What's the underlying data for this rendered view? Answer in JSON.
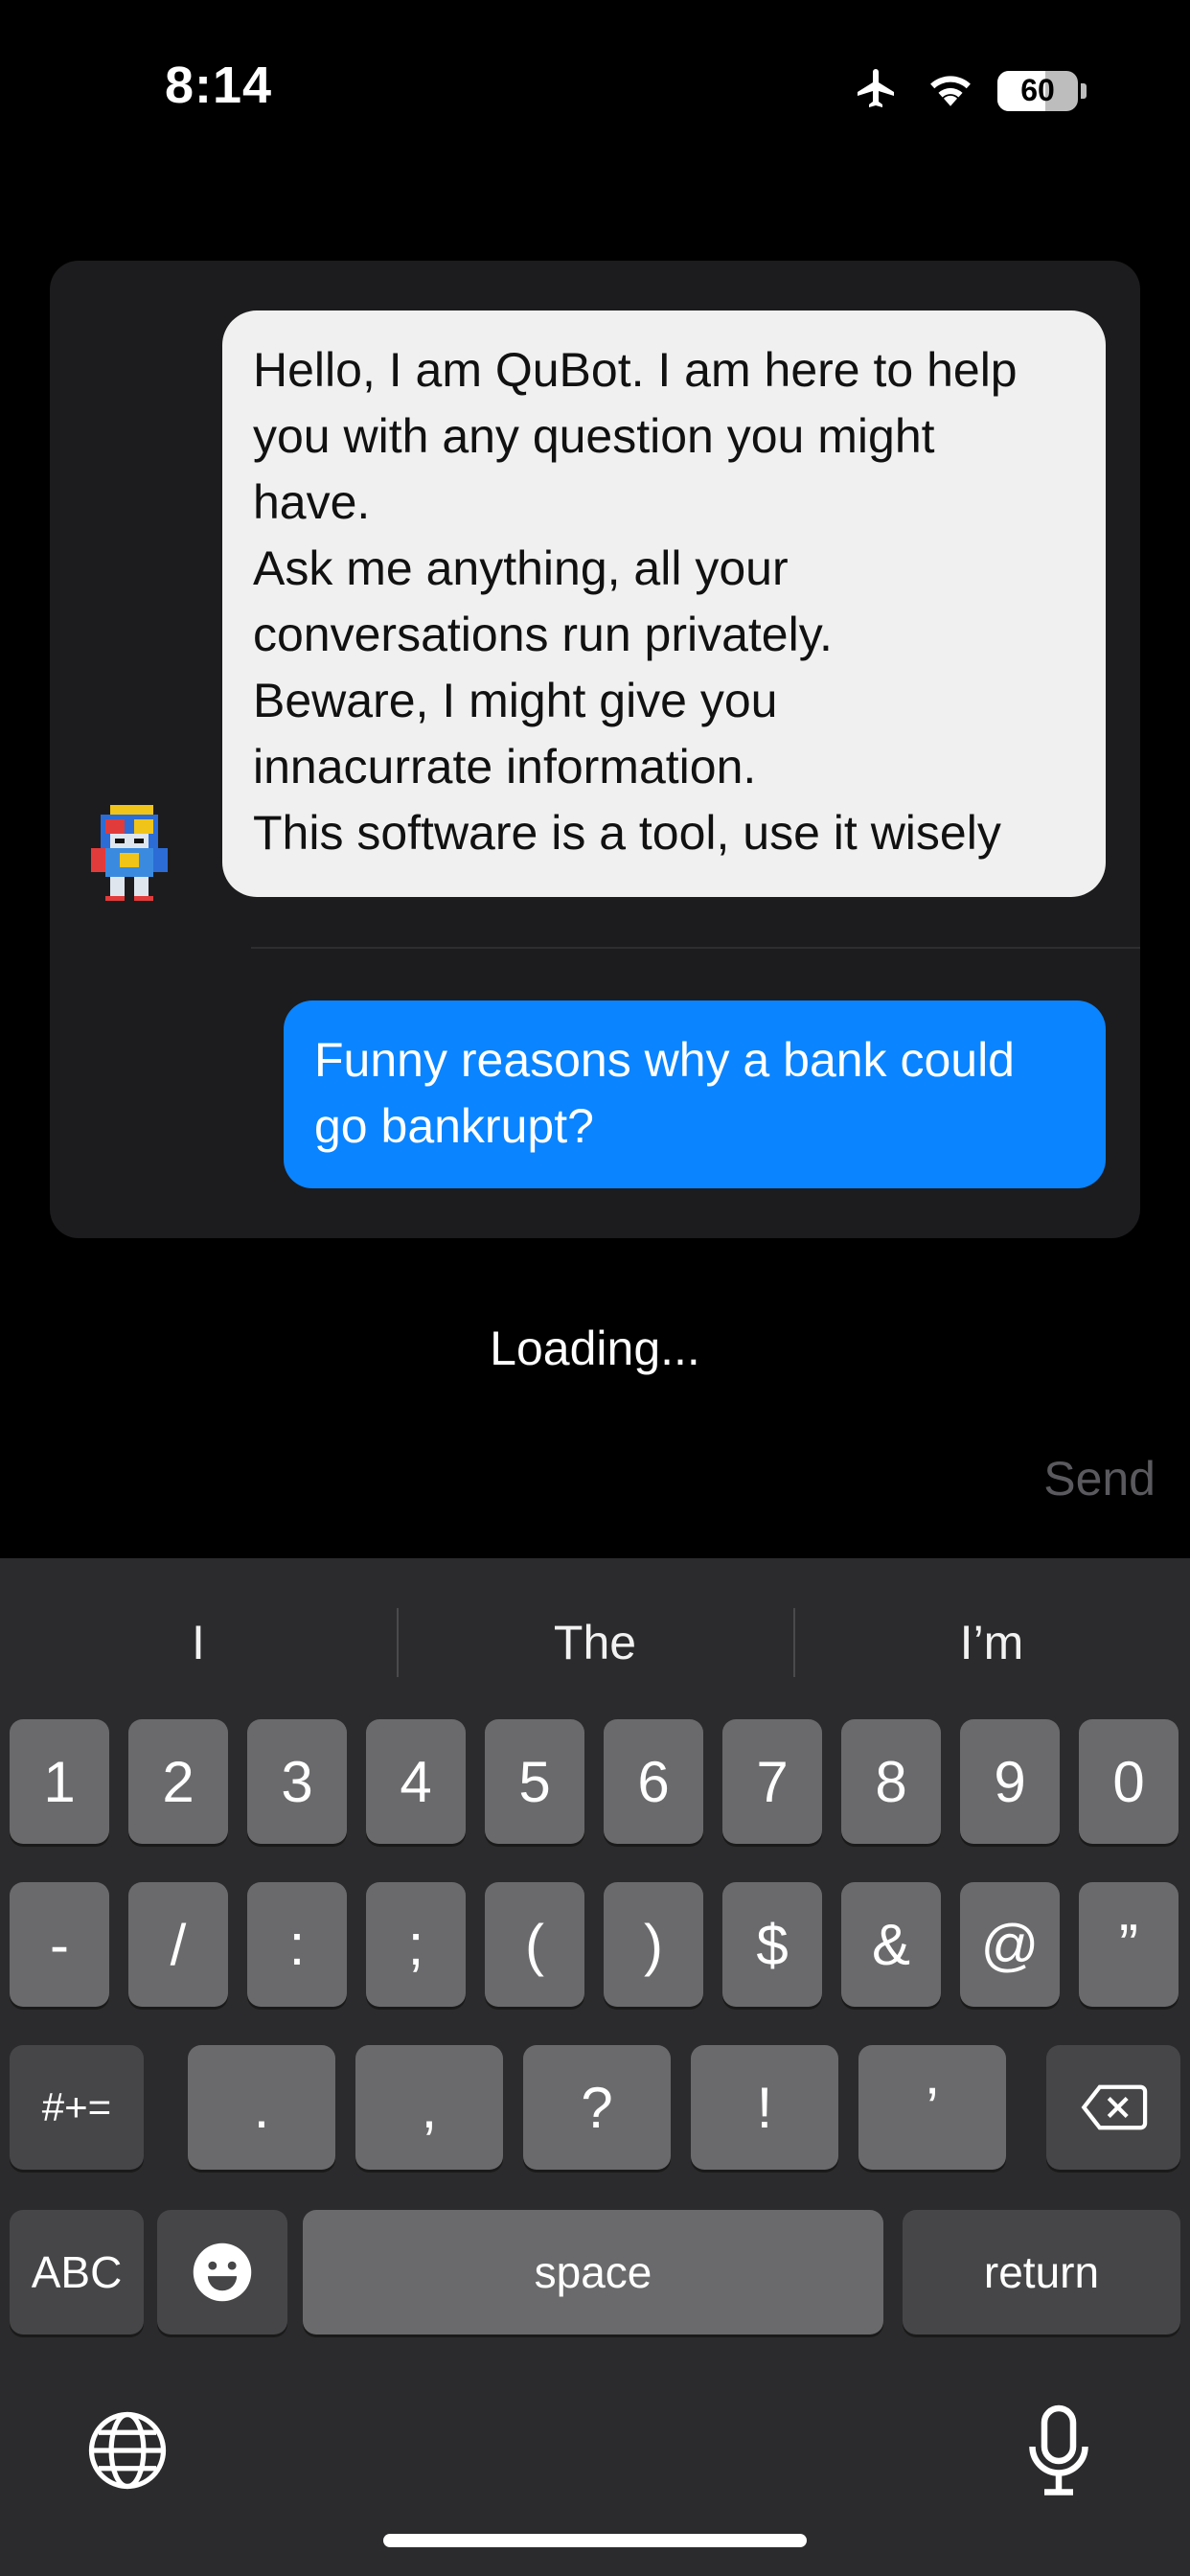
{
  "status_bar": {
    "time": "8:14",
    "battery_level": "60",
    "battery_fraction": 0.6,
    "icons": [
      "airplane-icon",
      "wifi-icon",
      "battery-icon"
    ]
  },
  "chat": {
    "bot_message_lines": [
      "Hello, I am QuBot. I am here to help",
      "you with any question you might",
      "have.",
      "Ask me anything, all your",
      "conversations run privately.",
      "Beware, I might give you",
      "innacurrate information.",
      "This software is a tool, use it wisely"
    ],
    "user_message": "Funny reasons why a bank could go bankrupt?",
    "user_bubble_color": "#0a84ff",
    "bot_bubble_color": "#f0f0f0"
  },
  "loading_text": "Loading...",
  "send_label": "Send",
  "keyboard": {
    "suggestions": [
      "I",
      "The",
      "I’m"
    ],
    "row1": [
      "1",
      "2",
      "3",
      "4",
      "5",
      "6",
      "7",
      "8",
      "9",
      "0"
    ],
    "row2": [
      "-",
      "/",
      ":",
      ";",
      "(",
      ")",
      "$",
      "&",
      "@",
      "”"
    ],
    "row3_left": "#+=",
    "row3": [
      ".",
      ",",
      "?",
      "!",
      "’"
    ],
    "row4_left": "ABC",
    "space_label": "space",
    "return_label": "return"
  }
}
